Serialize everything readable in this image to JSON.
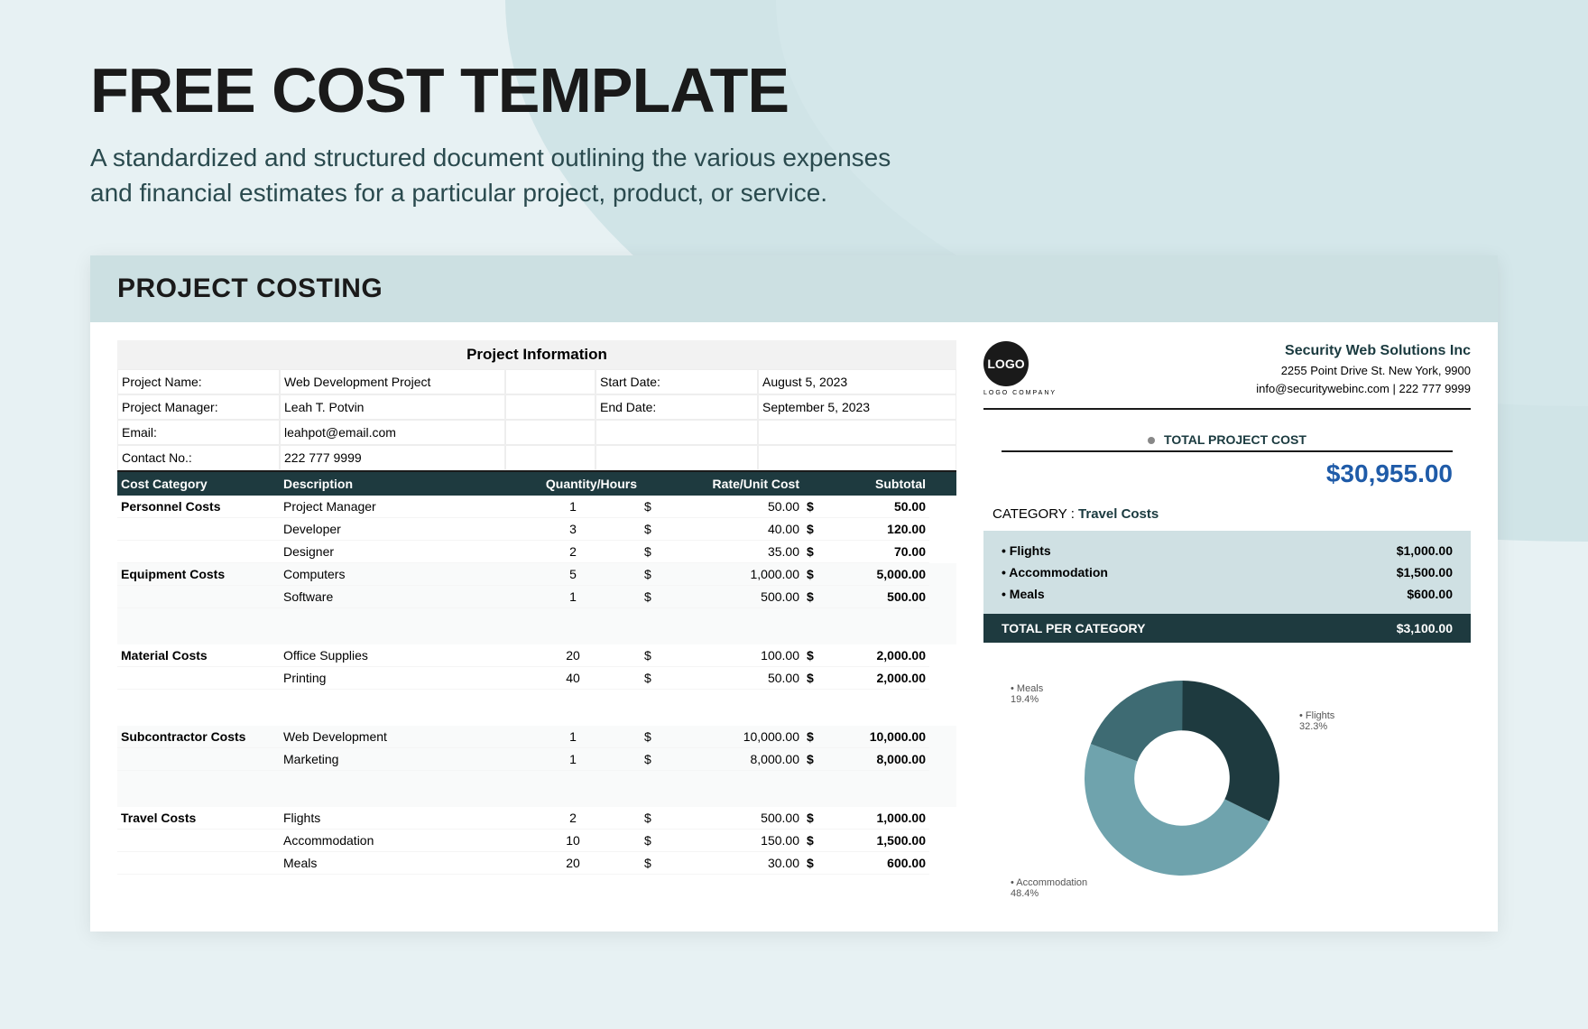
{
  "header": {
    "title": "FREE COST TEMPLATE",
    "subtitle": "A standardized and structured document outlining the various expenses and financial estimates for a particular project, product, or service."
  },
  "doc_title": "PROJECT COSTING",
  "project_info": {
    "header": "Project Information",
    "rows": [
      {
        "l1": "Project Name:",
        "v1": "Web Development Project",
        "l2": "Start Date:",
        "v2": "August 5, 2023"
      },
      {
        "l1": "Project Manager:",
        "v1": "Leah T. Potvin",
        "l2": "End Date:",
        "v2": "September 5, 2023"
      },
      {
        "l1": "Email:",
        "v1": "leahpot@email.com",
        "l2": "",
        "v2": ""
      },
      {
        "l1": "Contact No.:",
        "v1": "222 777 9999",
        "l2": "",
        "v2": ""
      }
    ]
  },
  "cost_headers": {
    "c1": "Cost Category",
    "c2": "Description",
    "c3": "Quantity/Hours",
    "c4": "Rate/Unit Cost",
    "c5": "Subtotal"
  },
  "costs": [
    {
      "cat": "Personnel Costs",
      "items": [
        {
          "desc": "Project Manager",
          "qty": "1",
          "rate": "50.00",
          "sub": "50.00"
        },
        {
          "desc": "Developer",
          "qty": "3",
          "rate": "40.00",
          "sub": "120.00"
        },
        {
          "desc": "Designer",
          "qty": "2",
          "rate": "35.00",
          "sub": "70.00"
        }
      ],
      "alt": false
    },
    {
      "cat": "Equipment Costs",
      "items": [
        {
          "desc": "Computers",
          "qty": "5",
          "rate": "1,000.00",
          "sub": "5,000.00"
        },
        {
          "desc": "Software",
          "qty": "1",
          "rate": "500.00",
          "sub": "500.00"
        }
      ],
      "alt": true
    },
    {
      "cat": "Material Costs",
      "items": [
        {
          "desc": "Office Supplies",
          "qty": "20",
          "rate": "100.00",
          "sub": "2,000.00"
        },
        {
          "desc": "Printing",
          "qty": "40",
          "rate": "50.00",
          "sub": "2,000.00"
        }
      ],
      "alt": false
    },
    {
      "cat": "Subcontractor Costs",
      "items": [
        {
          "desc": "Web Development",
          "qty": "1",
          "rate": "10,000.00",
          "sub": "10,000.00"
        },
        {
          "desc": "Marketing",
          "qty": "1",
          "rate": "8,000.00",
          "sub": "8,000.00"
        }
      ],
      "alt": true
    },
    {
      "cat": "Travel Costs",
      "items": [
        {
          "desc": "Flights",
          "qty": "2",
          "rate": "500.00",
          "sub": "1,000.00"
        },
        {
          "desc": "Accommodation",
          "qty": "10",
          "rate": "150.00",
          "sub": "1,500.00"
        },
        {
          "desc": "Meals",
          "qty": "20",
          "rate": "30.00",
          "sub": "600.00"
        }
      ],
      "alt": false
    }
  ],
  "company": {
    "logo_text": "LOGO",
    "logo_sub": "LOGO COMPANY",
    "name": "Security Web Solutions Inc",
    "addr": "2255  Point Drive St. New York, 9900",
    "contact": "info@securitywebinc.com  |  222 777 9999"
  },
  "totals": {
    "label": "TOTAL PROJECT COST",
    "value": "$30,955.00",
    "cat_prefix": "CATEGORY :",
    "cat_name": "Travel Costs",
    "items": [
      {
        "name": "• Flights",
        "val": "$1,000.00"
      },
      {
        "name": "• Accommodation",
        "val": "$1,500.00"
      },
      {
        "name": "• Meals",
        "val": "$600.00"
      }
    ],
    "per_cat_label": "TOTAL PER CATEGORY",
    "per_cat_val": "$3,100.00"
  },
  "chart_data": {
    "type": "pie",
    "title": "",
    "slices": [
      {
        "label": "Flights",
        "pct": 32.3,
        "display": "32.3%",
        "color": "#1e3a3f"
      },
      {
        "label": "Accommodation",
        "pct": 48.4,
        "display": "48.4%",
        "color": "#6fa3ad"
      },
      {
        "label": "Meals",
        "pct": 19.4,
        "display": "19.4%",
        "color": "#3e6b73"
      }
    ]
  }
}
